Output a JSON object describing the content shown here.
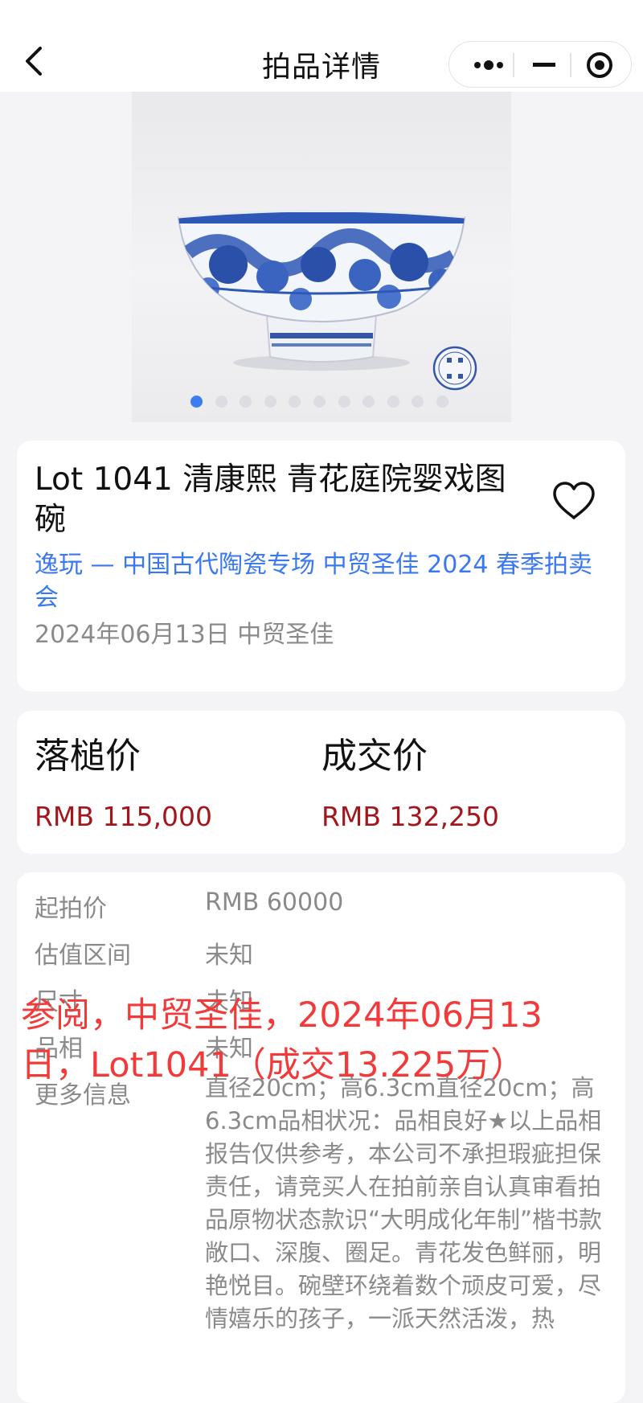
{
  "nav": {
    "title": "拍品详情",
    "back_icon": "chevron-left-icon",
    "menu_icon": "more-dots-icon",
    "minimize_icon": "minus-icon",
    "close_icon": "target-circle-icon"
  },
  "gallery": {
    "image": "blue-white-porcelain-bowl",
    "slide_count": 11,
    "active_index": 0,
    "active_color": "#3c7cf1"
  },
  "lot": {
    "title": "Lot 1041 清康熙 青花庭院婴戏图碗",
    "auction": "逸玩 — 中国古代陶瓷专场 中贸圣佳 2024 春季拍卖会",
    "meta": "2024年06月13日 中贸圣佳",
    "favorite_icon": "heart-icon"
  },
  "prices": {
    "hammer_label": "落槌价",
    "hammer_value": "RMB 115,000",
    "deal_label": "成交价",
    "deal_value": "RMB 132,250",
    "value_color": "#a2161c"
  },
  "details": {
    "start_label": "起拍价",
    "start_value": "RMB 60000",
    "estimate_label": "估值区间",
    "estimate_value": "未知",
    "size_label": "尺寸",
    "size_value": "未知",
    "condition_label": "品相",
    "condition_value": "未知",
    "more_label": "更多信息",
    "more_value": "直径20cm；高6.3cm直径20cm；高6.3cm品相状况：品相良好★以上品相报告仅供参考，本公司不承担瑕疵担保责任，请竞买人在拍前亲自认真审看拍品原物状态款识“大明成化年制”楷书款敞口、深腹、圈足。青花发色鲜丽，明艳悦目。碗壁环绕着数个顽皮可爱，尽情嬉乐的孩子，一派天然活泼，热"
  },
  "overlay": {
    "text": "参阅，中贸圣佳，2024年06月13日，Lot1041（成交13.225万）",
    "color": "#f23a3a"
  }
}
